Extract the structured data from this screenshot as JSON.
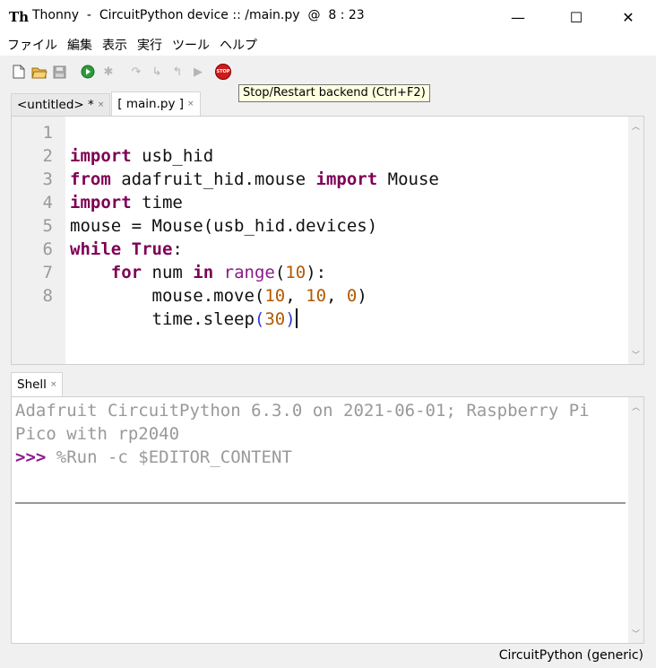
{
  "window": {
    "title": "Thonny  -  CircuitPython device :: /main.py  @  8 : 23",
    "minimize": "—",
    "maximize": "☐",
    "close": "✕"
  },
  "menu": [
    "ファイル",
    "編集",
    "表示",
    "実行",
    "ツール",
    "ヘルプ"
  ],
  "toolbar": {
    "tooltip": "Stop/Restart backend (Ctrl+F2)",
    "stop_label": "STOP"
  },
  "editor": {
    "tabs": [
      {
        "label": "<untitled> *",
        "close": "×"
      },
      {
        "label": "[ main.py ]",
        "close": "×"
      }
    ],
    "line_numbers": [
      "1",
      "2",
      "3",
      "4",
      "5",
      "6",
      "7",
      "8"
    ],
    "code": {
      "l1_kw": "import",
      "l1_rest": " usb_hid",
      "l2_kw1": "from",
      "l2_mid": " adafruit_hid.mouse ",
      "l2_kw2": "import",
      "l2_rest": " Mouse",
      "l3_kw": "import",
      "l3_rest": " time",
      "l4": "mouse = Mouse(usb_hid.devices)",
      "l5_kw1": "while",
      "l5_kw2": "True",
      "l5_rest": ":",
      "l6_indent": "    ",
      "l6_kw1": "for",
      "l6_mid": " num ",
      "l6_kw2": "in",
      "l6_bi": "range",
      "l6_open": "(",
      "l6_num": "10",
      "l6_close": "):",
      "l7_indent": "        ",
      "l7_call": "mouse.move(",
      "l7_n1": "10",
      "l7_sep1": ", ",
      "l7_n2": "10",
      "l7_sep2": ", ",
      "l7_n3": "0",
      "l7_close": ")",
      "l8_indent": "        ",
      "l8_call": "time.sleep",
      "l8_open": "(",
      "l8_num": "30",
      "l8_close": ")"
    }
  },
  "shell": {
    "tab": {
      "label": "Shell",
      "close": "×"
    },
    "banner_line1": "Adafruit CircuitPython 6.3.0 on 2021-06-01; Raspberry Pi",
    "banner_line2": "Pico with rp2040",
    "prompt": ">>>",
    "command": " %Run -c $EDITOR_CONTENT"
  },
  "status": {
    "interpreter": "CircuitPython (generic)"
  }
}
